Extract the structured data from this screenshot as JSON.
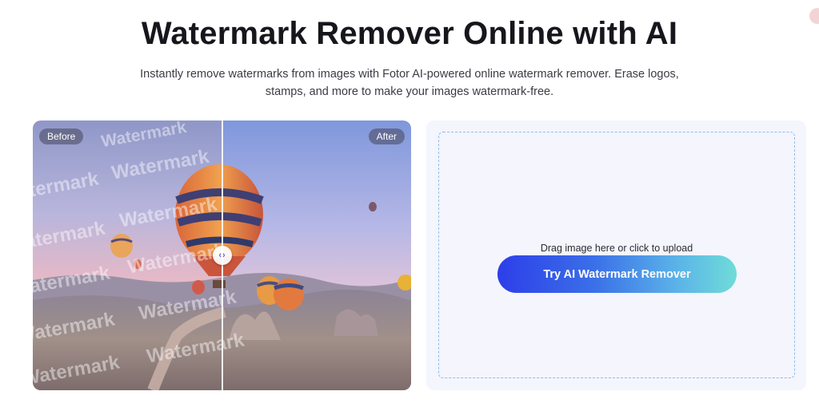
{
  "header": {
    "title": "Watermark Remover Online with AI",
    "subtitle": "Instantly remove watermarks from images with Fotor AI-powered online watermark remover. Erase logos, stamps, and more to make your images watermark-free."
  },
  "demo": {
    "before_label": "Before",
    "after_label": "After",
    "watermark_text": "Watermark",
    "handle_glyph": "‹›"
  },
  "upload": {
    "drag_text": "Drag image here or click to upload",
    "cta_label": "Try AI Watermark Remover"
  },
  "colors": {
    "cta_start": "#2d3ee9",
    "cta_end": "#6fdcd8",
    "panel_bg": "#f4f5fd",
    "dropzone_border": "#8fbde8"
  }
}
